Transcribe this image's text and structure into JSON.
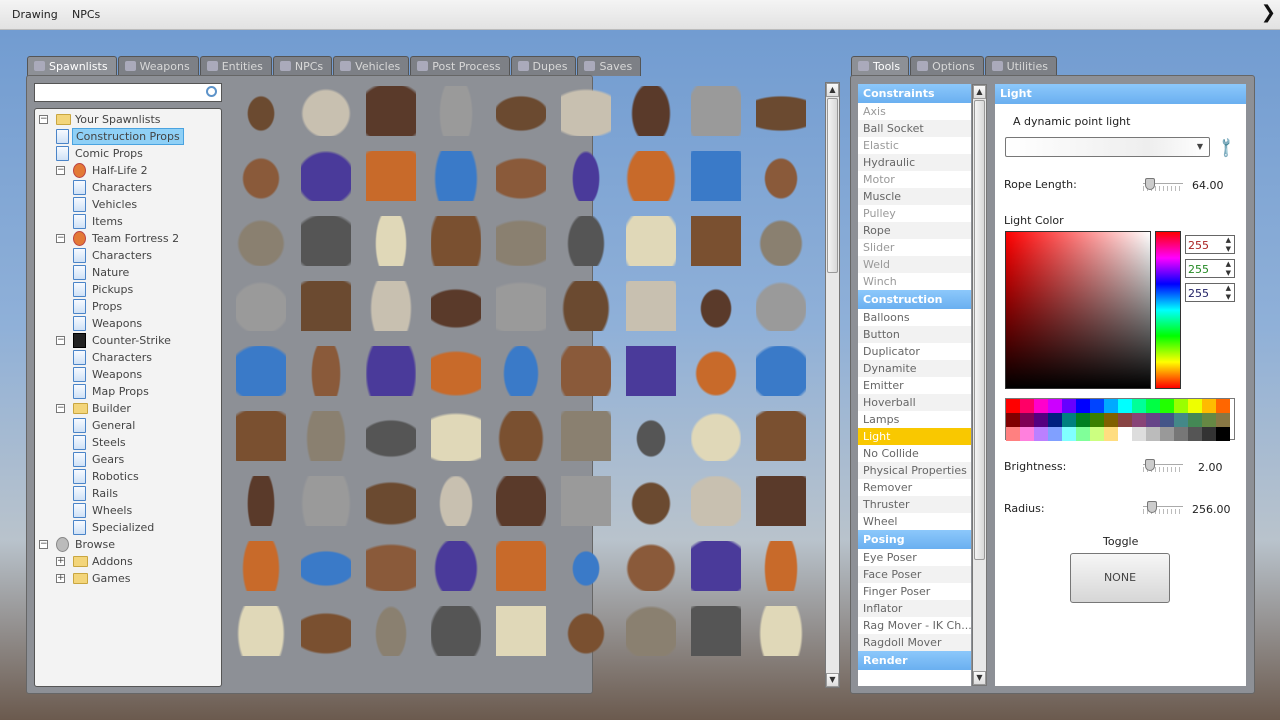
{
  "menubar": {
    "items": [
      "Drawing",
      "NPCs"
    ]
  },
  "left_tabs": [
    {
      "label": "Spawnlists",
      "active": true,
      "icon": "grid-icon"
    },
    {
      "label": "Weapons",
      "icon": "gun-icon"
    },
    {
      "label": "Entities",
      "icon": "cubes-icon"
    },
    {
      "label": "NPCs",
      "icon": "monkey-icon"
    },
    {
      "label": "Vehicles",
      "icon": "car-icon"
    },
    {
      "label": "Post Process",
      "icon": "picture-icon"
    },
    {
      "label": "Dupes",
      "icon": "dupe-icon"
    },
    {
      "label": "Saves",
      "icon": "saves-icon"
    }
  ],
  "search": {
    "value": "",
    "placeholder": ""
  },
  "tree": [
    {
      "label": "Your Spawnlists",
      "level": 0,
      "icon": "folder",
      "expander": "-"
    },
    {
      "label": "Construction Props",
      "level": 1,
      "icon": "page",
      "selected": true
    },
    {
      "label": "Comic Props",
      "level": 1,
      "icon": "page"
    },
    {
      "label": "Half-Life 2",
      "level": 1,
      "icon": "game",
      "expander": "-"
    },
    {
      "label": "Characters",
      "level": 2,
      "icon": "page"
    },
    {
      "label": "Vehicles",
      "level": 2,
      "icon": "page"
    },
    {
      "label": "Items",
      "level": 2,
      "icon": "page"
    },
    {
      "label": "Team Fortress 2",
      "level": 1,
      "icon": "game",
      "expander": "-"
    },
    {
      "label": "Characters",
      "level": 2,
      "icon": "page"
    },
    {
      "label": "Nature",
      "level": 2,
      "icon": "page"
    },
    {
      "label": "Pickups",
      "level": 2,
      "icon": "page"
    },
    {
      "label": "Props",
      "level": 2,
      "icon": "page"
    },
    {
      "label": "Weapons",
      "level": 2,
      "icon": "page"
    },
    {
      "label": "Counter-Strike",
      "level": 1,
      "icon": "cs",
      "expander": "-"
    },
    {
      "label": "Characters",
      "level": 2,
      "icon": "page"
    },
    {
      "label": "Weapons",
      "level": 2,
      "icon": "page"
    },
    {
      "label": "Map Props",
      "level": 2,
      "icon": "page"
    },
    {
      "label": "Builder",
      "level": 1,
      "icon": "folder",
      "expander": "-"
    },
    {
      "label": "General",
      "level": 2,
      "icon": "page"
    },
    {
      "label": "Steels",
      "level": 2,
      "icon": "page"
    },
    {
      "label": "Gears",
      "level": 2,
      "icon": "page"
    },
    {
      "label": "Robotics",
      "level": 2,
      "icon": "page"
    },
    {
      "label": "Rails",
      "level": 2,
      "icon": "page"
    },
    {
      "label": "Wheels",
      "level": 2,
      "icon": "page"
    },
    {
      "label": "Specialized",
      "level": 2,
      "icon": "page"
    },
    {
      "label": "Browse",
      "level": 0,
      "icon": "gear",
      "expander": "-"
    },
    {
      "label": "Addons",
      "level": 1,
      "icon": "folder",
      "expander": "+"
    },
    {
      "label": "Games",
      "level": 1,
      "icon": "folder",
      "expander": "+"
    }
  ],
  "right_tabs": [
    {
      "label": "Tools",
      "active": true,
      "icon": "wrench-icon"
    },
    {
      "label": "Options",
      "icon": "wrench-icon"
    },
    {
      "label": "Utilities",
      "icon": "utilities-icon"
    }
  ],
  "tool_categories": [
    {
      "title": "Constraints",
      "items": [
        "Axis",
        "Ball Socket",
        "Elastic",
        "Hydraulic",
        "Motor",
        "Muscle",
        "Pulley",
        "Rope",
        "Slider",
        "Weld",
        "Winch"
      ]
    },
    {
      "title": "Construction",
      "items": [
        "Balloons",
        "Button",
        "Duplicator",
        "Dynamite",
        "Emitter",
        "Hoverball",
        "Lamps",
        "Light",
        "No Collide",
        "Physical Properties",
        "Remover",
        "Thruster",
        "Wheel"
      ],
      "selected": "Light"
    },
    {
      "title": "Posing",
      "items": [
        "Eye Poser",
        "Face Poser",
        "Finger Poser",
        "Inflator",
        "Rag Mover - IK Ch...",
        "Ragdoll Mover"
      ]
    },
    {
      "title": "Render",
      "items": []
    }
  ],
  "tool_panel": {
    "title": "Light",
    "description": "A dynamic point light",
    "preset_value": "",
    "rope_length": {
      "label": "Rope Length:",
      "value": "64.00",
      "fraction": 0.1
    },
    "light_color": {
      "label": "Light Color",
      "r": "255",
      "g": "255",
      "b": "255"
    },
    "brightness": {
      "label": "Brightness:",
      "value": "2.00",
      "fraction": 0.08
    },
    "radius": {
      "label": "Radius:",
      "value": "256.00",
      "fraction": 0.12
    },
    "toggle": {
      "label": "Toggle",
      "button": "NONE"
    }
  },
  "palette": [
    [
      "#ff0000",
      "#ff0066",
      "#ff00cc",
      "#cc00ff",
      "#6600ff",
      "#0000ff",
      "#0044ff",
      "#00aaff",
      "#00ffff",
      "#00ff99",
      "#00ff44",
      "#22ff00",
      "#99ff00",
      "#eeff00",
      "#ffbb00",
      "#ff6600"
    ],
    [
      "#800000",
      "#800055",
      "#550080",
      "#002080",
      "#008080",
      "#008020",
      "#3a8000",
      "#806000",
      "#884444",
      "#884477",
      "#664488",
      "#445588",
      "#448888",
      "#448855",
      "#668844",
      "#887744"
    ],
    [
      "#ff8080",
      "#ff80dd",
      "#bb80ff",
      "#80a0ff",
      "#80ffff",
      "#80ff99",
      "#ccff80",
      "#ffdd80",
      "#ffffff",
      "#dddddd",
      "#bbbbbb",
      "#999999",
      "#777777",
      "#555555",
      "#333333",
      "#000000"
    ]
  ]
}
